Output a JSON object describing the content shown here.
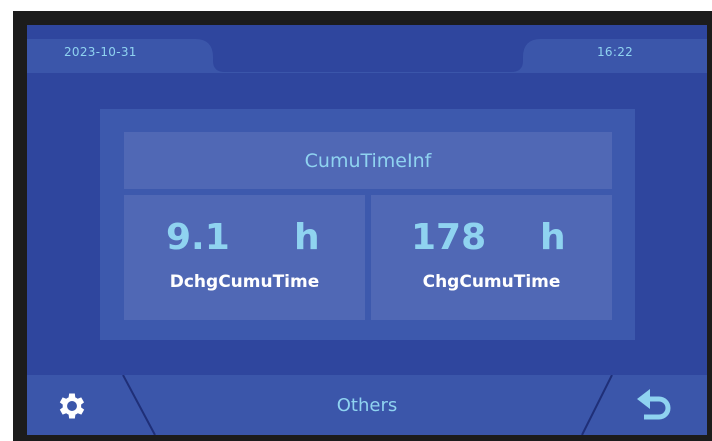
{
  "status_bar": {
    "date": "2023-10-31",
    "time": "16:22"
  },
  "panel": {
    "title": "CumuTimeInf",
    "metrics": [
      {
        "value": "9.1",
        "unit": "h",
        "label": "DchgCumuTime"
      },
      {
        "value": "178",
        "unit": "h",
        "label": "ChgCumuTime"
      }
    ]
  },
  "footer": {
    "title": "Others",
    "left_icon": "gear-icon",
    "right_icon": "back-arrow-icon"
  },
  "colors": {
    "screen_bg": "#2f469e",
    "bar_bg": "#3b56aa",
    "cell_bg": "#5068b5",
    "accent_text": "#8fd3f0"
  }
}
